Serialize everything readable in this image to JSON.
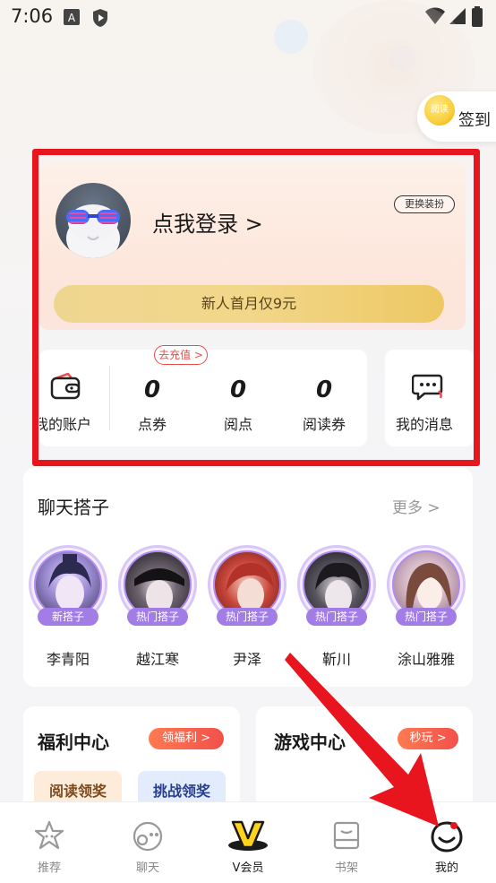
{
  "status_bar": {
    "time": "7:06"
  },
  "checkin": {
    "coin_text": "阅读",
    "label": "签到"
  },
  "profile": {
    "login_text": "点我登录 >",
    "costume_button": "更换装扮",
    "vip_promo": "新人首月仅9元"
  },
  "stats": {
    "account_label": "我的账户",
    "recharge_badge": "去充值 >",
    "items": [
      {
        "value": "0",
        "label": "点券"
      },
      {
        "value": "0",
        "label": "阅点"
      },
      {
        "value": "0",
        "label": "阅读券"
      }
    ],
    "messages_label": "我的消息"
  },
  "chat_partners": {
    "title": "聊天搭子",
    "more": "更多 >",
    "items": [
      {
        "name": "李青阳",
        "tag": "新搭子"
      },
      {
        "name": "越江寒",
        "tag": "热门搭子"
      },
      {
        "name": "尹泽",
        "tag": "热门搭子"
      },
      {
        "name": "靳川",
        "tag": "热门搭子"
      },
      {
        "name": "涂山雅雅",
        "tag": "热门搭子"
      }
    ]
  },
  "welfare": {
    "title": "福利中心",
    "badge": "领福利 >",
    "tiles": [
      "阅读领奖",
      "挑战领奖"
    ]
  },
  "games": {
    "title": "游戏中心",
    "badge": "秒玩 >"
  },
  "tab_bar": {
    "items": [
      {
        "label": "推荐",
        "icon": "star-face-icon"
      },
      {
        "label": "聊天",
        "icon": "chat-face-icon"
      },
      {
        "label": "V会员",
        "icon": "vip-v-icon"
      },
      {
        "label": "书架",
        "icon": "bookshelf-icon"
      },
      {
        "label": "我的",
        "icon": "me-face-icon"
      }
    ],
    "active": "我的"
  },
  "colors": {
    "annotation_red": "#e8151e",
    "vip_gold": "#f2d78a",
    "partner_purple": "#a27de6",
    "welfare_pill": "#f2504a"
  }
}
